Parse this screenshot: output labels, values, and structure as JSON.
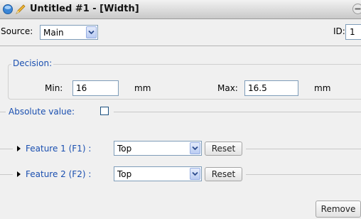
{
  "window": {
    "title": "Untitled #1 - [Width]"
  },
  "icons": {
    "orb": "window-orb-icon",
    "pen": "pencil-icon",
    "collapse": "collapse-icon",
    "dropdown": "chevron-down-icon",
    "expand": "triangle-right-icon"
  },
  "toolbar": {
    "source_label": "Source:",
    "source_value": "Main",
    "id_label": "ID:",
    "id_value": "1"
  },
  "decision": {
    "legend": "Decision:",
    "min_label": "Min:",
    "min_value": "16",
    "min_unit": "mm",
    "max_label": "Max:",
    "max_value": "16.5",
    "max_unit": "mm"
  },
  "absolute_value": {
    "label": "Absolute value:",
    "checked": false
  },
  "features": [
    {
      "label": "Feature 1 (F1) :",
      "value": "Top",
      "reset_label": "Reset"
    },
    {
      "label": "Feature 2 (F2) :",
      "value": "Top",
      "reset_label": "Reset"
    }
  ],
  "remove_label": "Remove",
  "colors": {
    "accent": "#1a4fb0",
    "panel": "#f0f0f0"
  }
}
